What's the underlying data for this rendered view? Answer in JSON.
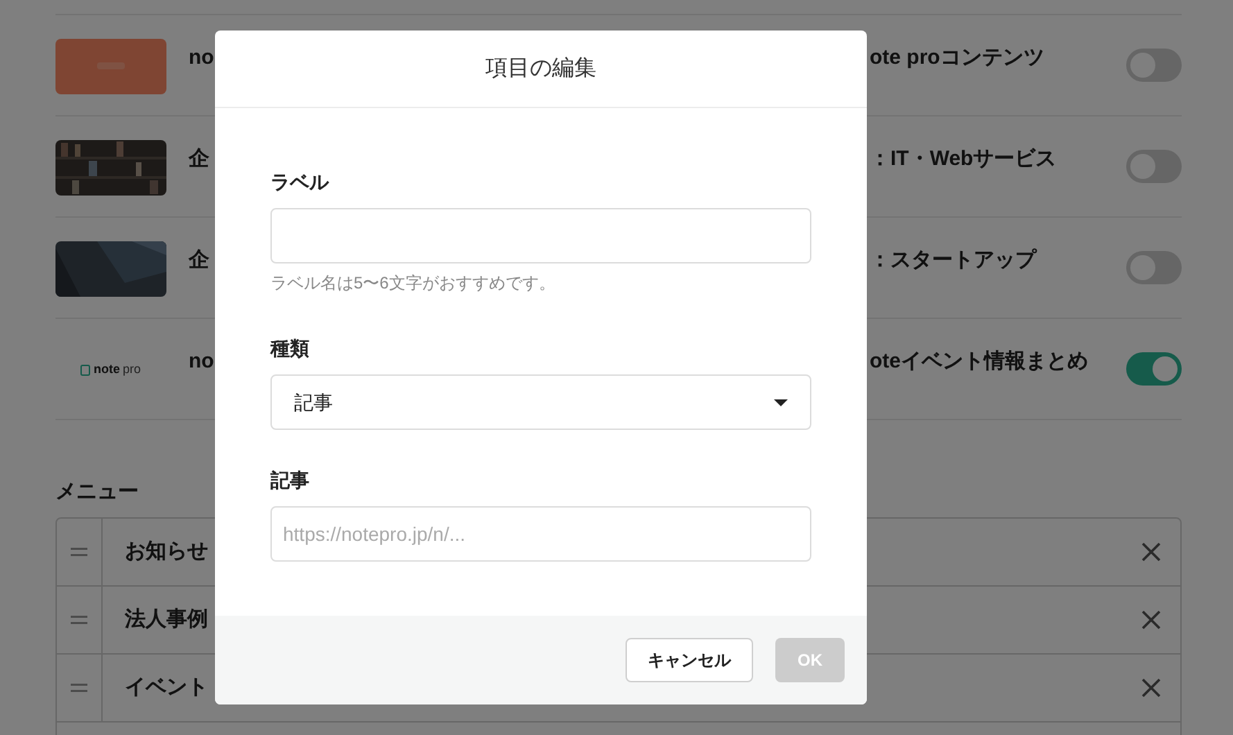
{
  "magazines": [
    {
      "title_start": "no",
      "title_end": "ote proコンテンツ",
      "on": false
    },
    {
      "title_start": "企",
      "title_end": "：IT・Webサービス",
      "on": false
    },
    {
      "title_start": "企",
      "title_end": "：スタートアップ",
      "on": false
    },
    {
      "thumbnail": {
        "kind": "logo",
        "word": "note",
        "suffix": "pro"
      },
      "title_start": "no",
      "title_end": "oteイベント情報まとめ",
      "on": true
    }
  ],
  "menu": {
    "heading": "メニュー",
    "items": [
      {
        "label": "お知らせ"
      },
      {
        "label": "法人事例"
      },
      {
        "label": "イベント"
      }
    ]
  },
  "dialog": {
    "title": "項目の編集",
    "fields": [
      {
        "kind": "text",
        "label": "ラベル",
        "hint": "ラベル名は5〜6文字がおすすめです。"
      },
      {
        "kind": "select",
        "label": "種類",
        "value": "記事"
      },
      {
        "kind": "text",
        "label": "記事",
        "placeholder": "https://notepro.jp/n/..."
      }
    ],
    "buttons": [
      {
        "label": "キャンセル",
        "kind": "secondary",
        "disabled": false
      },
      {
        "label": "OK",
        "kind": "primary",
        "disabled": true
      }
    ]
  }
}
